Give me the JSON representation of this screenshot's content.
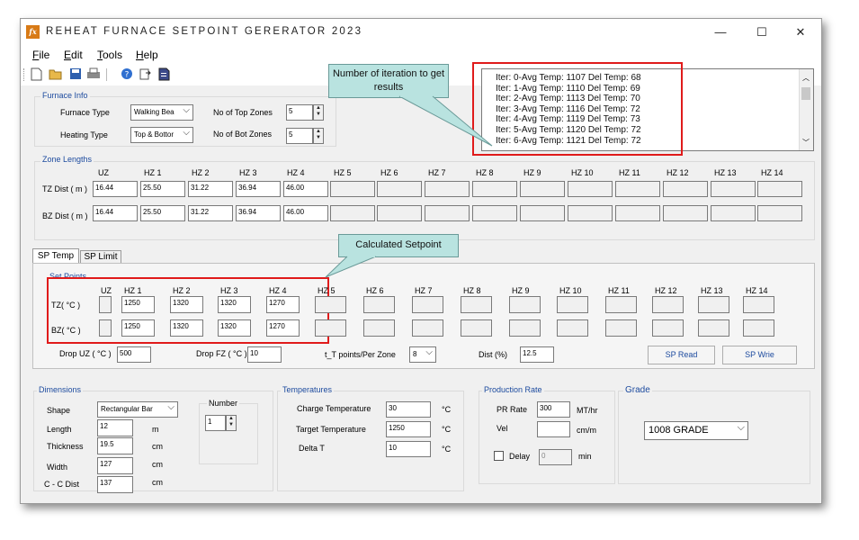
{
  "window": {
    "title": "REHEAT FURNACE SETPOINT GERERATOR 2023",
    "app_icon": "fx",
    "minimize": "—",
    "maximize": "☐",
    "close": "✕"
  },
  "menu": [
    {
      "label": "File",
      "key": "F",
      "rest": "ile"
    },
    {
      "label": "Edit",
      "key": "E",
      "rest": "dit"
    },
    {
      "label": "Tools",
      "key": "T",
      "rest": "ools"
    },
    {
      "label": "Help",
      "key": "H",
      "rest": "elp"
    }
  ],
  "toolbar_icons": [
    "new-file-icon",
    "open-folder-icon",
    "save-icon",
    "print-icon",
    "help-icon",
    "export-icon",
    "document-icon"
  ],
  "furnace_info": {
    "group": "Furnace Info",
    "furnace_type_label": "Furnace Type",
    "furnace_type_value": "Walking Bea",
    "heating_type_label": "Heating Type",
    "heating_type_value": "Top & Bottor",
    "top_zones_label": "No of Top Zones",
    "top_zones_value": "5",
    "bot_zones_label": "No of Bot Zones",
    "bot_zones_value": "5"
  },
  "iteration_log": [
    "Iter: 0-Avg Temp: 1107 Del Temp: 68",
    "Iter: 1-Avg Temp: 1110 Del Temp: 69",
    "Iter: 2-Avg Temp: 1113 Del Temp: 70",
    "Iter: 3-Avg Temp: 1116 Del Temp: 72",
    "Iter: 4-Avg Temp: 1119 Del Temp: 73",
    "Iter: 5-Avg Temp: 1120 Del Temp: 72",
    "Iter: 6-Avg Temp: 1121 Del Temp: 72"
  ],
  "callouts": {
    "iterations": "Number  of iteration to get results",
    "setpoint": "Calculated Setpoint"
  },
  "zone_lengths": {
    "group": "Zone Lengths",
    "headers": [
      "UZ",
      "HZ 1",
      "HZ 2",
      "HZ 3",
      "HZ 4",
      "HZ 5",
      "HZ 6",
      "HZ 7",
      "HZ 8",
      "HZ 9",
      "HZ 10",
      "HZ 11",
      "HZ 12",
      "HZ 13",
      "HZ 14"
    ],
    "tz_label": "TZ Dist ( m )",
    "tz_values": [
      "16.44",
      "25.50",
      "31.22",
      "36.94",
      "46.00",
      "",
      "",
      "",
      "",
      "",
      "",
      "",
      "",
      "",
      ""
    ],
    "bz_label": "BZ Dist ( m )",
    "bz_values": [
      "16.44",
      "25.50",
      "31.22",
      "36.94",
      "46.00",
      "",
      "",
      "",
      "",
      "",
      "",
      "",
      "",
      "",
      ""
    ]
  },
  "tabs": [
    "SP Temp",
    "SP Limit"
  ],
  "set_points": {
    "group": "Set Points",
    "headers": [
      "UZ",
      "HZ 1",
      "HZ 2",
      "HZ 3",
      "HZ 4",
      "HZ 5",
      "HZ 6",
      "HZ 7",
      "HZ 8",
      "HZ 9",
      "HZ 10",
      "HZ 11",
      "HZ 12",
      "HZ 13",
      "HZ 14"
    ],
    "tz_label": "TZ( °C )",
    "tz_values": [
      "",
      "1250",
      "1320",
      "1320",
      "1270",
      "",
      "",
      "",
      "",
      "",
      "",
      "",
      "",
      "",
      ""
    ],
    "bz_label": "BZ( °C )",
    "bz_values": [
      "",
      "1250",
      "1320",
      "1320",
      "1270",
      "",
      "",
      "",
      "",
      "",
      "",
      "",
      "",
      "",
      ""
    ],
    "drop_uz_label": "Drop UZ ( °C )",
    "drop_uz_value": "500",
    "drop_fz_label": "Drop FZ ( °C )",
    "drop_fz_value": "10",
    "t_points_label": "t_T points/Per Zone",
    "t_points_value": "8",
    "dist_label": "Dist (%)",
    "dist_value": "12.5",
    "sp_read": "SP Read",
    "sp_write": "SP Wrie"
  },
  "dimensions": {
    "group": "Dimensions",
    "shape_label": "Shape",
    "shape_value": "Rectangular Bar",
    "length_label": "Length",
    "length_value": "12",
    "length_unit": "m",
    "thickness_label": "Thickness",
    "thickness_value": "19.5",
    "thickness_unit": "cm",
    "width_label": "Width",
    "width_value": "127",
    "width_unit": "cm",
    "cc_label": "C - C Dist",
    "cc_value": "137",
    "cc_unit": "cm",
    "number_label": "Number",
    "number_value": "1"
  },
  "temperatures": {
    "group": "Temperatures",
    "charge_label": "Charge Temperature",
    "charge_value": "30",
    "target_label": "Target Temperature",
    "target_value": "1250",
    "delta_label": "Delta T",
    "delta_value": "10",
    "unit": "°C"
  },
  "production": {
    "group": "Production Rate",
    "pr_label": "PR Rate",
    "pr_value": "300",
    "pr_unit": "MT/hr",
    "vel_label": "Vel",
    "vel_value": "",
    "vel_unit": "cm/m",
    "delay_label": "Delay",
    "delay_value": "0",
    "delay_unit": "min"
  },
  "grade": {
    "group": "Grade",
    "value": "1008 GRADE"
  },
  "colors": {
    "annotation_red": "#e01b1b",
    "callout_fill": "#b9e3e0",
    "group_label": "#1c4a9e",
    "app_icon": "#d87a16"
  }
}
